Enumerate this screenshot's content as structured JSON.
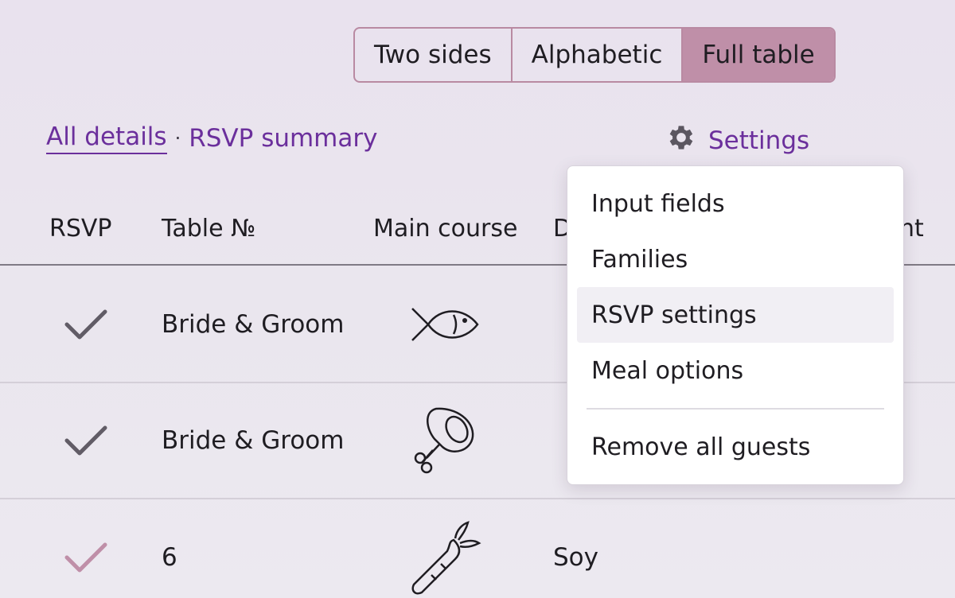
{
  "view_switch": {
    "options": [
      "Two sides",
      "Alphabetic",
      "Full table"
    ],
    "active": "Full table"
  },
  "nav": {
    "all_details": "All details",
    "separator": "·",
    "rsvp_summary": "RSVP summary"
  },
  "settings": {
    "label": "Settings",
    "icon": "gear-icon"
  },
  "table": {
    "headers": {
      "rsvp": "RSVP",
      "table_no": "Table №",
      "main_course": "Main course",
      "diet_partial": "D",
      "last_partial": "nt"
    },
    "rows": [
      {
        "rsvp": "check",
        "rsvp_color": "#615c66",
        "table": "Bride & Groom",
        "meal_icon": "fish-icon",
        "diet": ""
      },
      {
        "rsvp": "check",
        "rsvp_color": "#615c66",
        "table": "Bride & Groom",
        "meal_icon": "meat-icon",
        "diet": ""
      },
      {
        "rsvp": "check",
        "rsvp_color": "#bf8fa8",
        "table": "6",
        "meal_icon": "carrot-icon",
        "diet": "Soy"
      }
    ]
  },
  "dropdown": {
    "items": [
      "Input fields",
      "Families",
      "RSVP settings",
      "Meal options"
    ],
    "hovered": "RSVP settings",
    "danger_item": "Remove all guests"
  },
  "colors": {
    "accent_purple": "#6b2f9c",
    "segment_active": "#bf8fa8",
    "segment_border": "#b98aa2"
  }
}
